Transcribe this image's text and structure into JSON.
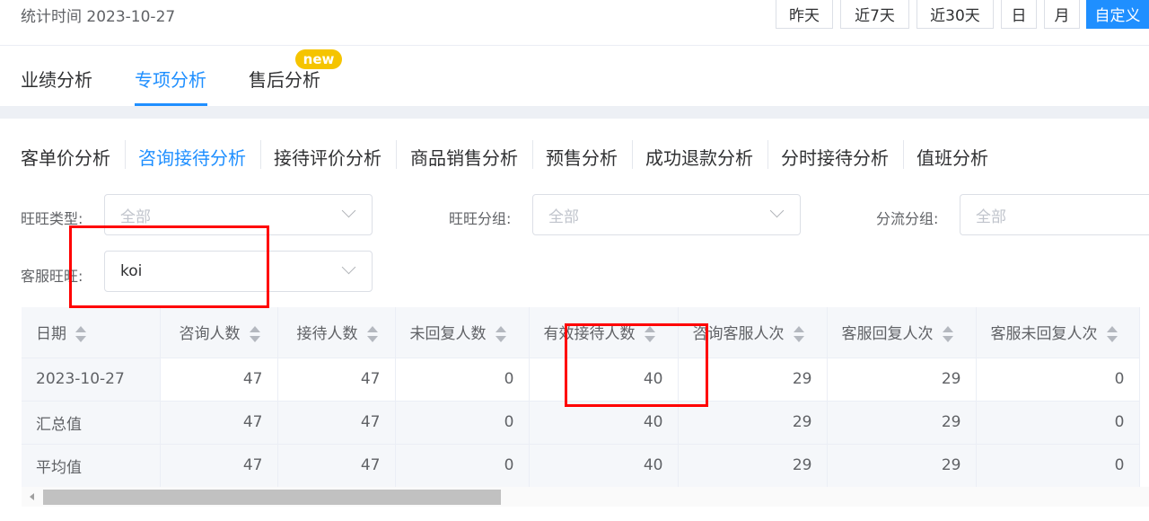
{
  "stat_date": "统计时间 2023-10-27",
  "range_buttons": [
    "昨天",
    "近7天",
    "近30天",
    "日",
    "月",
    "自定义"
  ],
  "main_tabs": [
    "业绩分析",
    "专项分析",
    "售后分析"
  ],
  "new_badge": "new",
  "sub_tabs": [
    "客单价分析",
    "咨询接待分析",
    "接待评价分析",
    "商品销售分析",
    "预售分析",
    "成功退款分析",
    "分时接待分析",
    "值班分析"
  ],
  "filters": {
    "wangwang_type": {
      "label": "旺旺类型:",
      "value": "全部"
    },
    "wangwang_group": {
      "label": "旺旺分组:",
      "value": "全部"
    },
    "split_group": {
      "label": "分流分组:",
      "value": "全部"
    },
    "cs_wangwang": {
      "label": "客服旺旺:",
      "value": "koi"
    }
  },
  "table": {
    "headers": [
      "日期",
      "咨询人数",
      "接待人数",
      "未回复人数",
      "有效接待人数",
      "咨询客服人次",
      "客服回复人次",
      "客服未回复人次"
    ],
    "rows": [
      [
        "2023-10-27",
        "47",
        "47",
        "0",
        "40",
        "29",
        "29",
        "0"
      ],
      [
        "汇总值",
        "47",
        "47",
        "0",
        "40",
        "29",
        "29",
        "0"
      ],
      [
        "平均值",
        "47",
        "47",
        "0",
        "40",
        "29",
        "29",
        "0"
      ]
    ]
  },
  "colors": {
    "accent": "#1f8fff",
    "badge": "#f5c400",
    "highlight": "#ff0000"
  }
}
